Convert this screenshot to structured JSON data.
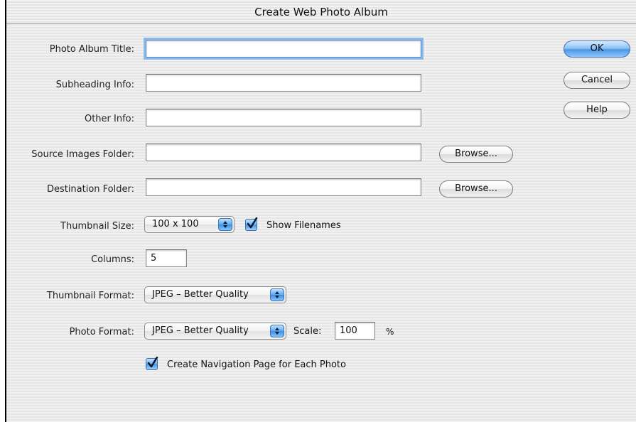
{
  "window": {
    "title": "Create Web Photo Album"
  },
  "fields": {
    "title_label": "Photo Album Title:",
    "subheading_label": "Subheading Info:",
    "other_label": "Other Info:",
    "source_label": "Source Images Folder:",
    "destination_label": "Destination Folder:",
    "thumb_size_label": "Thumbnail Size:",
    "columns_label": "Columns:",
    "thumb_format_label": "Thumbnail Format:",
    "photo_format_label": "Photo Format:",
    "title_value": "",
    "subheading_value": "",
    "other_value": "",
    "source_value": "",
    "destination_value": "",
    "columns_value": "5",
    "thumb_size_value": "100 x 100",
    "thumb_format_value": "JPEG – Better Quality",
    "photo_format_value": "JPEG – Better Quality",
    "scale_label": "Scale:",
    "scale_value": "100",
    "scale_unit": "%"
  },
  "checkboxes": {
    "show_filenames": {
      "label": "Show Filenames",
      "checked": true
    },
    "create_nav": {
      "label": "Create Navigation Page for Each Photo",
      "checked": true
    }
  },
  "buttons": {
    "browse": "Browse...",
    "ok": "OK",
    "cancel": "Cancel",
    "help": "Help"
  },
  "colors": {
    "accent": "#5ea9ee"
  },
  "icons": {
    "checkmark": "checkmark-icon",
    "stepper": "popup-stepper-icon"
  }
}
